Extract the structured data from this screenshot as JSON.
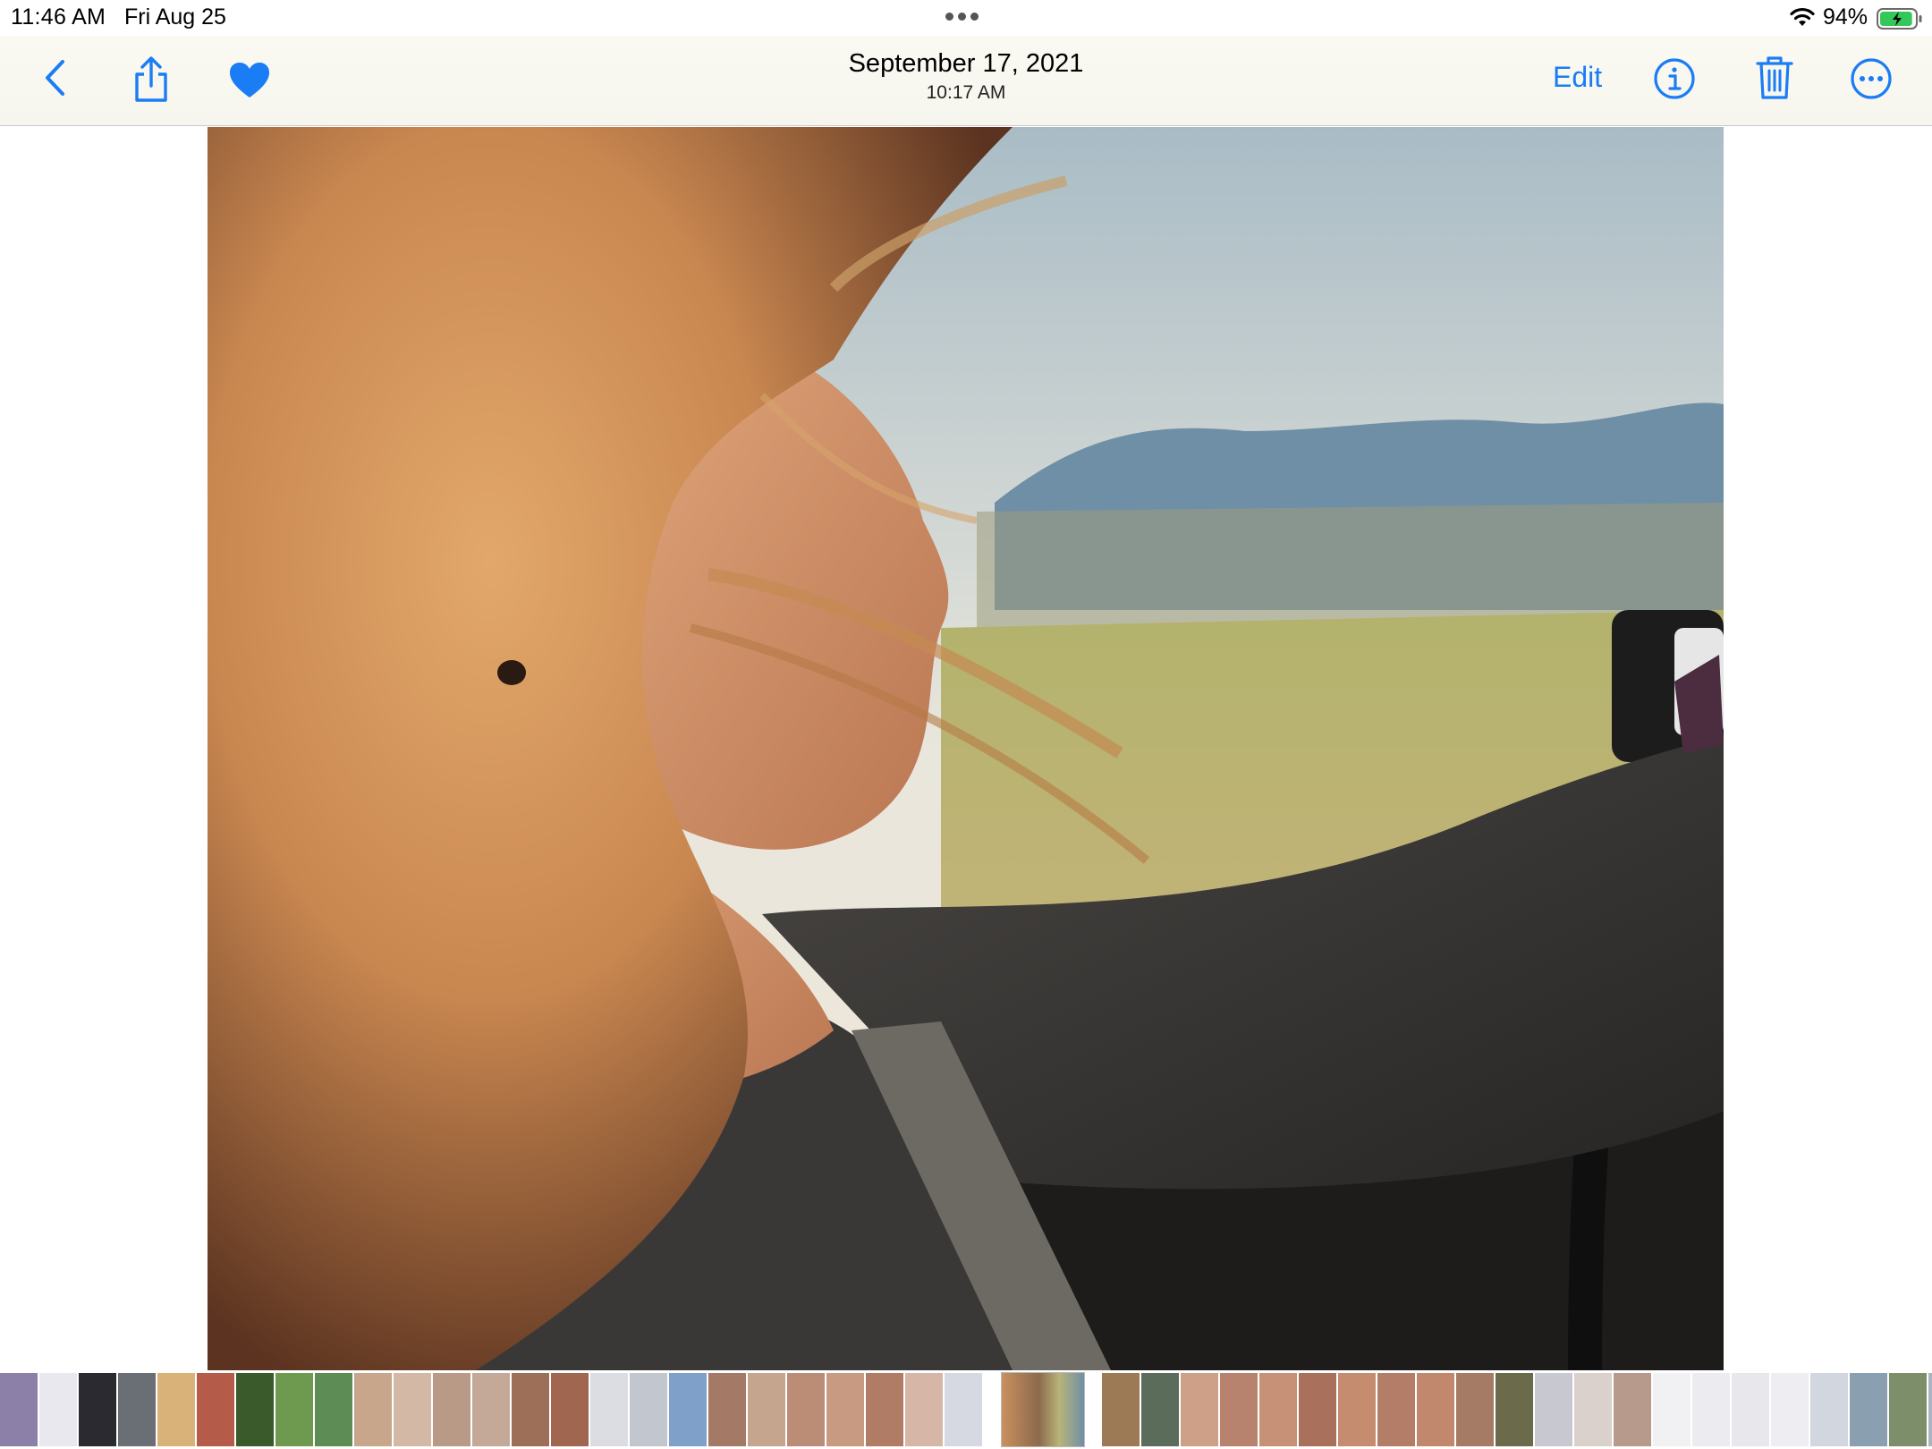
{
  "status_bar": {
    "time": "11:46 AM",
    "date": "Fri Aug 25",
    "battery_percent": "94%",
    "battery_level": 0.94,
    "battery_charging": true,
    "icons": [
      "wifi-icon",
      "battery-icon",
      "multitask-dots-icon"
    ]
  },
  "toolbar": {
    "title": "September 17, 2021",
    "subtitle": "10:17 AM",
    "edit_label": "Edit",
    "favorited": true,
    "icons": [
      "chevron-left-icon",
      "share-icon",
      "heart-icon",
      "info-icon",
      "trash-icon",
      "ellipsis-circle-icon"
    ]
  },
  "photo": {
    "subject": "photo-image"
  },
  "thumbnails": {
    "colors": [
      "#8c7fa8",
      "#e8e8ee",
      "#2a2a30",
      "#6a6f75",
      "#d9b27a",
      "#b45b4a",
      "#3b5a2c",
      "#6d9a4f",
      "#5e8c55",
      "#c7a68b",
      "#d4b8a6",
      "#b99a86",
      "#c4a898",
      "#9d6f58",
      "#a06650",
      "#dcdde2",
      "#c2c6cf",
      "#7fa0c8",
      "#a47a66",
      "#c6a58f",
      "#bb8d77",
      "#c89a82",
      "#b07c66",
      "#d6b6a6",
      "#d6d9e1",
      "#e3e4ea",
      "#9b7a55",
      "#5b6d5a",
      "#cfa088",
      "#b8836e",
      "#c79177",
      "#a9715b",
      "#c68c70",
      "#b37d67",
      "#c2886e",
      "#a67b65",
      "#6b6a4a",
      "#c8c9d0",
      "#dad0cc",
      "#b89a8c",
      "#f1f1f3",
      "#ececf0",
      "#e8e8ec",
      "#eeeef2",
      "#d2d6de",
      "#8aa0b0",
      "#7d8f6a",
      "#a8b6bf",
      "#c8c8c8",
      "#c89878"
    ],
    "current_index": 25
  },
  "colors": {
    "accent": "#1a7df5",
    "toolbar_background": "#f8f7f0",
    "battery_fill": "#34c759"
  }
}
